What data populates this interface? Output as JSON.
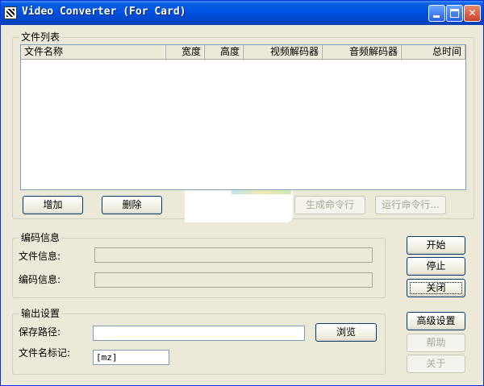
{
  "window": {
    "title": "Video Converter (For Card)"
  },
  "file_list": {
    "legend": "文件列表",
    "columns": [
      "文件名称",
      "宽度",
      "高度",
      "视频解码器",
      "音频解码器",
      "总时间"
    ],
    "add_label": "增加",
    "delete_label": "删除",
    "gen_cmd_label": "生成命令行",
    "run_cmd_label": "运行命令行..."
  },
  "encode_info": {
    "legend": "编码信息",
    "file_info_label": "文件信息:",
    "file_info_value": "",
    "encode_info_label": "编码信息:",
    "encode_info_value": ""
  },
  "output": {
    "legend": "输出设置",
    "save_path_label": "保存路径:",
    "save_path_value": "",
    "browse_label": "浏览",
    "filename_tag_label": "文件名标记:",
    "filename_tag_value": "[mz]"
  },
  "actions": {
    "start": "开始",
    "stop": "停止",
    "close": "关闭",
    "advanced": "高级设置",
    "help": "帮助",
    "about": "关于"
  }
}
